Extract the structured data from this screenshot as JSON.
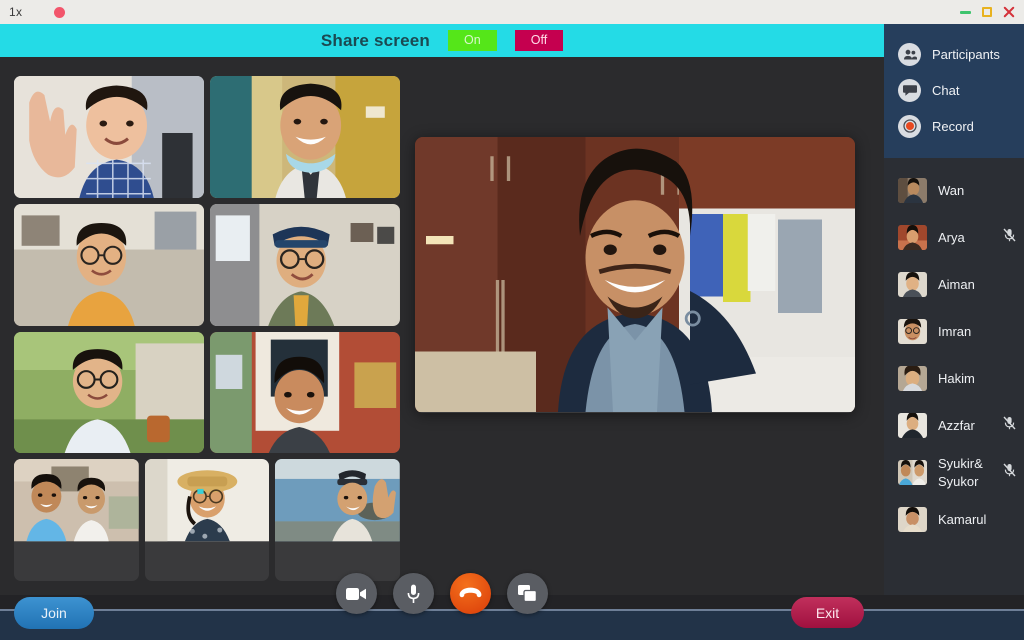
{
  "titlebar": {
    "zoom_label": "1x",
    "record_dot": "record-dot",
    "minimize": "minimize-icon",
    "maximize": "maximize-icon",
    "close": "close-icon"
  },
  "sharebar": {
    "label": "Share screen",
    "on_label": "On",
    "off_label": "Off",
    "bg_color": "#24dbe6",
    "on_color": "#55e619",
    "off_color": "#c5004f"
  },
  "sidebar": {
    "bg_top_color": "#263e5c",
    "bg_list_color": "#2b2e34",
    "actions": [
      {
        "label": "Participants",
        "icon": "participants-icon"
      },
      {
        "label": "Chat",
        "icon": "chat-icon"
      },
      {
        "label": "Record",
        "icon": "record-icon"
      }
    ],
    "participants": [
      {
        "name": "Wan",
        "muted": false
      },
      {
        "name": "Arya",
        "muted": true
      },
      {
        "name": "Aiman",
        "muted": false
      },
      {
        "name": "Imran",
        "muted": false
      },
      {
        "name": "Hakim",
        "muted": false
      },
      {
        "name": "Azzfar",
        "muted": true
      },
      {
        "name": "Syukir&\nSyukor",
        "muted": true
      },
      {
        "name": "Kamarul",
        "muted": false
      }
    ]
  },
  "bottombar": {
    "join_label": "Join",
    "exit_label": "Exit",
    "bg_color": "#223348",
    "join_color": "#2173b4",
    "exit_color": "#a0113f",
    "controls": [
      {
        "name": "video-camera-icon",
        "label": ""
      },
      {
        "name": "microphone-icon",
        "label": ""
      },
      {
        "name": "end-call-icon",
        "label": ""
      },
      {
        "name": "screen-share-icon",
        "label": ""
      }
    ]
  },
  "stage": {
    "bg_color": "#2b2b2d",
    "speaker": {
      "name": "active-speaker-video"
    },
    "grid_rows": [
      [
        {
          "name": "participant-video-1"
        },
        {
          "name": "participant-video-2"
        }
      ],
      [
        {
          "name": "participant-video-3"
        },
        {
          "name": "participant-video-4"
        }
      ],
      [
        {
          "name": "participant-video-5"
        },
        {
          "name": "participant-video-6"
        }
      ],
      [
        {
          "name": "participant-video-7"
        },
        {
          "name": "participant-video-8"
        },
        {
          "name": "participant-video-9"
        }
      ]
    ]
  }
}
